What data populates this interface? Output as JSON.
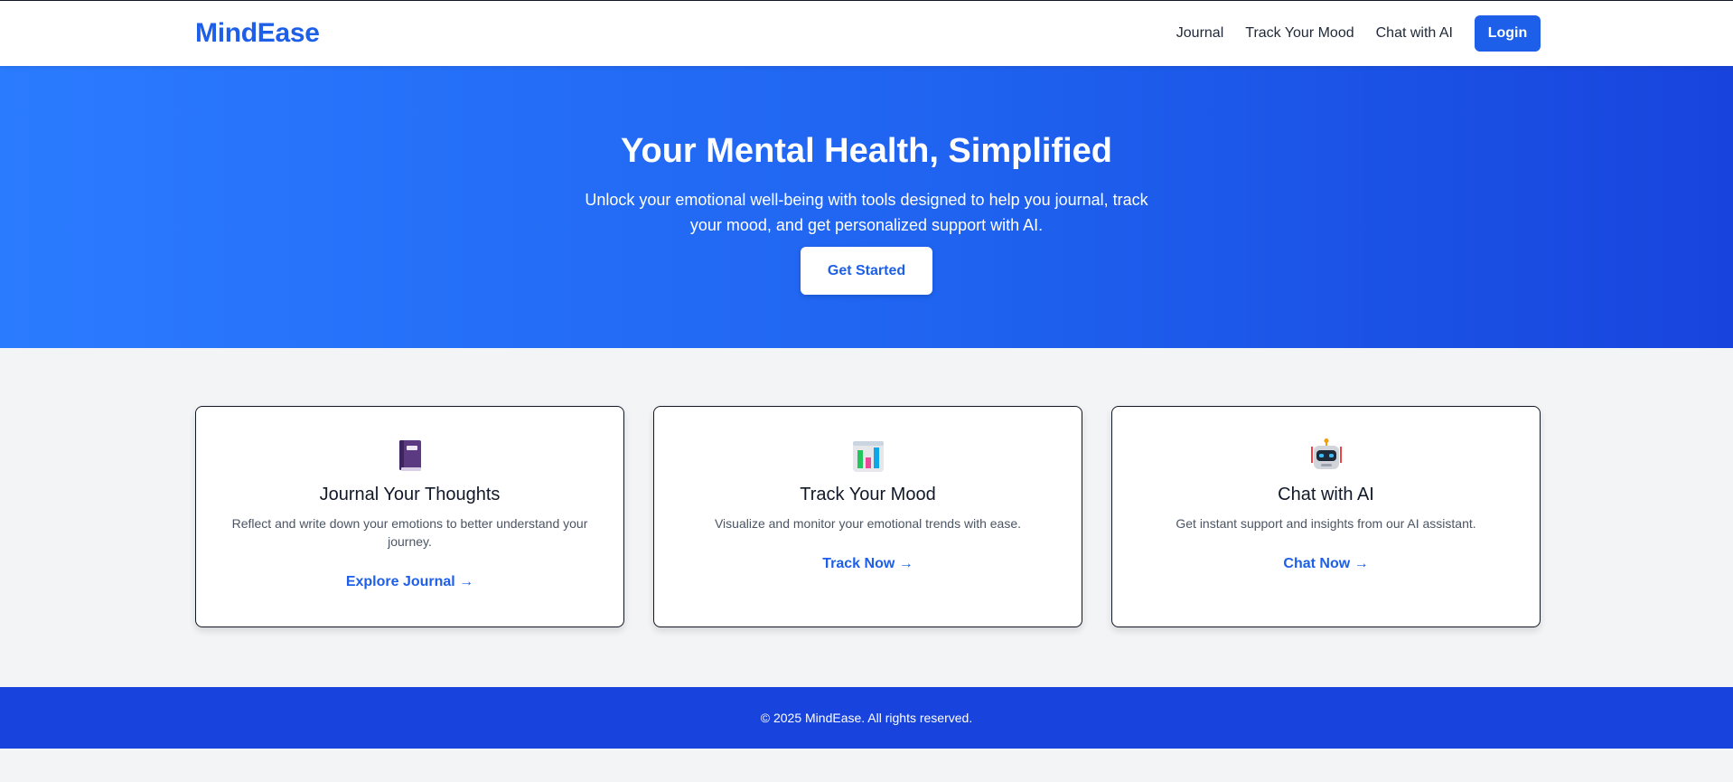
{
  "header": {
    "logo": "MindEase",
    "nav": [
      {
        "label": "Journal"
      },
      {
        "label": "Track Your Mood"
      },
      {
        "label": "Chat with AI"
      }
    ],
    "login_label": "Login"
  },
  "hero": {
    "title": "Your Mental Health, Simplified",
    "subtitle": "Unlock your emotional well-being with tools designed to help you journal, track your mood, and get personalized support with AI.",
    "cta_label": "Get Started"
  },
  "features": [
    {
      "icon": "notebook-icon",
      "title": "Journal Your Thoughts",
      "description": "Reflect and write down your emotions to better understand your journey.",
      "link": "Explore Journal →"
    },
    {
      "icon": "bar-chart-icon",
      "title": "Track Your Mood",
      "description": "Visualize and monitor your emotional trends with ease.",
      "link": "Track Now →"
    },
    {
      "icon": "robot-icon",
      "title": "Chat with AI",
      "description": "Get instant support and insights from our AI assistant.",
      "link": "Chat Now →"
    }
  ],
  "footer": {
    "text": "© 2025 MindEase. All rights reserved."
  },
  "colors": {
    "brand": "#1d5fe8",
    "hero_start": "#2b7bff",
    "hero_end": "#1844dd",
    "footer": "#1844dd",
    "page_bg": "#f3f4f6"
  }
}
